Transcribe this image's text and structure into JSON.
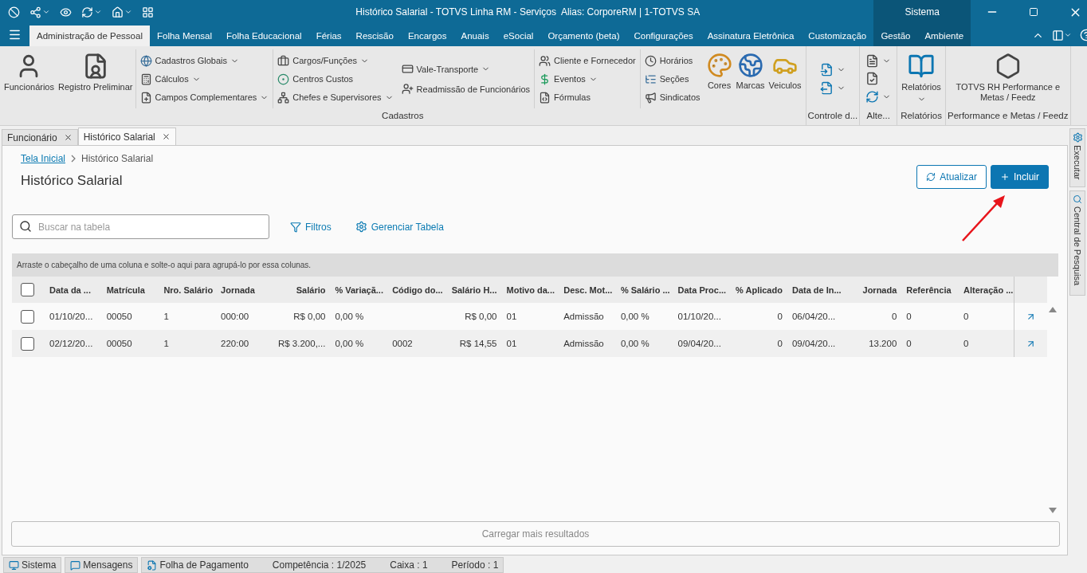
{
  "window": {
    "title": "Histórico Salarial - TOTVS Linha RM - Serviços  Alias: CorporeRM | 1-TOTVS SA"
  },
  "menu": {
    "tabs": [
      {
        "label": "Administração de Pessoal",
        "selected": true
      },
      {
        "label": "Folha Mensal",
        "selected": false
      },
      {
        "label": "Folha Educacional",
        "selected": false
      },
      {
        "label": "Férias",
        "selected": false
      },
      {
        "label": "Rescisão",
        "selected": false
      },
      {
        "label": "Encargos",
        "selected": false
      },
      {
        "label": "Anuais",
        "selected": false
      },
      {
        "label": "eSocial",
        "selected": false
      },
      {
        "label": "Orçamento (beta)",
        "selected": false
      },
      {
        "label": "Configurações",
        "selected": false
      },
      {
        "label": "Assinatura Eletrônica",
        "selected": false
      },
      {
        "label": "Customização",
        "selected": false
      }
    ],
    "context_group": {
      "label": "Sistema",
      "tabs": [
        {
          "label": "Gestão",
          "selected": false
        },
        {
          "label": "Ambiente",
          "selected": false
        }
      ]
    }
  },
  "ribbon": {
    "groups": [
      {
        "label": "Cadastros",
        "columns": [
          {
            "kind": "large",
            "items": [
              {
                "label": "Funcionários",
                "dropdown": false
              },
              {
                "label": "Registro Preliminar",
                "dropdown": false
              }
            ]
          },
          {
            "kind": "small",
            "items": [
              {
                "label": "Cadastros Globais",
                "dropdown": true
              },
              {
                "label": "Cálculos",
                "dropdown": true
              },
              {
                "label": "Campos Complementares",
                "dropdown": true
              }
            ]
          },
          {
            "kind": "small",
            "items": [
              {
                "label": "Cargos/Funções",
                "dropdown": true
              },
              {
                "label": "Centros Custos",
                "dropdown": false
              },
              {
                "label": "Chefes e Supervisores",
                "dropdown": true
              }
            ]
          },
          {
            "kind": "small",
            "items": [
              {
                "label": "Vale-Transporte",
                "dropdown": true
              },
              {
                "label": "Readmissão de Funcionários",
                "dropdown": false
              }
            ]
          },
          {
            "kind": "small",
            "items": [
              {
                "label": "Cliente e Fornecedor",
                "dropdown": false
              },
              {
                "label": "Eventos",
                "dropdown": true
              },
              {
                "label": "Fórmulas",
                "dropdown": false
              }
            ]
          },
          {
            "kind": "small",
            "items": [
              {
                "label": "Horários",
                "dropdown": false
              },
              {
                "label": "Seções",
                "dropdown": false
              },
              {
                "label": "Sindicatos",
                "dropdown": false
              }
            ]
          },
          {
            "kind": "large",
            "items": [
              {
                "label": "Cores",
                "dropdown": false
              },
              {
                "label": "Marcas",
                "dropdown": false
              },
              {
                "label": "Veiculos",
                "dropdown": false
              }
            ]
          }
        ]
      },
      {
        "label": "Controle d...",
        "columns": [
          {
            "kind": "icons",
            "items": [
              {
                "dropdown": true
              },
              {
                "dropdown": true
              }
            ]
          }
        ]
      },
      {
        "label": "Alte...",
        "columns": [
          {
            "kind": "icons",
            "items": [
              {
                "dropdown": true
              },
              {
                "dropdown": false
              },
              {
                "dropdown": true
              }
            ]
          }
        ]
      },
      {
        "label": "Relatórios",
        "columns": [
          {
            "kind": "large",
            "items": [
              {
                "label": "Relatórios",
                "dropdown": true
              }
            ]
          }
        ]
      },
      {
        "label": "Performance e Metas / Feedz",
        "columns": [
          {
            "kind": "large",
            "items": [
              {
                "label": "TOTVS RH Performance e Metas / Feedz",
                "dropdown": false
              }
            ]
          }
        ]
      }
    ]
  },
  "document_tabs": [
    {
      "label": "Funcionário",
      "selected": false
    },
    {
      "label": "Histórico Salarial",
      "selected": true
    }
  ],
  "page": {
    "breadcrumb": [
      {
        "label": "Tela Inicial",
        "kind": "link"
      },
      {
        "label": "Histórico Salarial",
        "kind": "current"
      }
    ],
    "title": "Histórico Salarial",
    "buttons": [
      {
        "label": "Atualizar",
        "kind": "outline"
      },
      {
        "label": "Incluir",
        "kind": "primary"
      }
    ],
    "search": {
      "placeholder": "Buscar na tabela"
    },
    "tools": [
      {
        "label": "Filtros",
        "kind": "filter"
      },
      {
        "label": "Gerenciar Tabela",
        "kind": "settings"
      }
    ],
    "group_hint": "Arraste o cabeçalho de uma coluna e solte-o aqui para agrupá-lo por essa colunas.",
    "table": {
      "select_all": {
        "checked": false
      },
      "columns": [
        {
          "label": "Data da ...",
          "numeric": false
        },
        {
          "label": "Matrícula",
          "numeric": false
        },
        {
          "label": "Nro. Salário",
          "numeric": false
        },
        {
          "label": "Jornada",
          "numeric": false
        },
        {
          "label": "Salário",
          "numeric": true
        },
        {
          "label": "% Variaçã...",
          "numeric": false
        },
        {
          "label": "Código do...",
          "numeric": false
        },
        {
          "label": "Salário H...",
          "numeric": true
        },
        {
          "label": "Motivo da...",
          "numeric": false
        },
        {
          "label": "Desc. Mot...",
          "numeric": false
        },
        {
          "label": "% Salário ...",
          "numeric": false
        },
        {
          "label": "Data Proc...",
          "numeric": false
        },
        {
          "label": "% Aplicado",
          "numeric": true
        },
        {
          "label": "Data de In...",
          "numeric": false
        },
        {
          "label": "Jornada",
          "numeric": true
        },
        {
          "label": "Referência",
          "numeric": false
        },
        {
          "label": "Alteração ...",
          "numeric": false
        }
      ],
      "rows": [
        {
          "checked": false,
          "cells": [
            "01/10/20...",
            "00050",
            "1",
            "000:00",
            "R$ 0,00",
            "0,00 %",
            null,
            "R$ 0,00",
            "01",
            "Admissão",
            "0,00 %",
            "01/10/20...",
            "0",
            "06/04/20...",
            "0",
            "0",
            "0"
          ]
        },
        {
          "checked": false,
          "cells": [
            "02/12/20...",
            "00050",
            "1",
            "220:00",
            "R$ 3.200,...",
            "0,00 %",
            "0002",
            "R$ 14,55",
            "01",
            "Admissão",
            "0,00 %",
            "09/04/20...",
            "0",
            "09/04/20...",
            "13.200",
            "0",
            "0"
          ]
        }
      ]
    },
    "load_more": "Carregar mais resultados"
  },
  "side_tabs": [
    "Executar",
    "Central de Pesquisa"
  ],
  "status_bar": {
    "buttons": [
      "Sistema",
      "Mensagens"
    ],
    "module": "Folha de Pagamento",
    "fields": [
      "Competência : 1/2025",
      "Caixa : 1",
      "Período : 1"
    ]
  }
}
